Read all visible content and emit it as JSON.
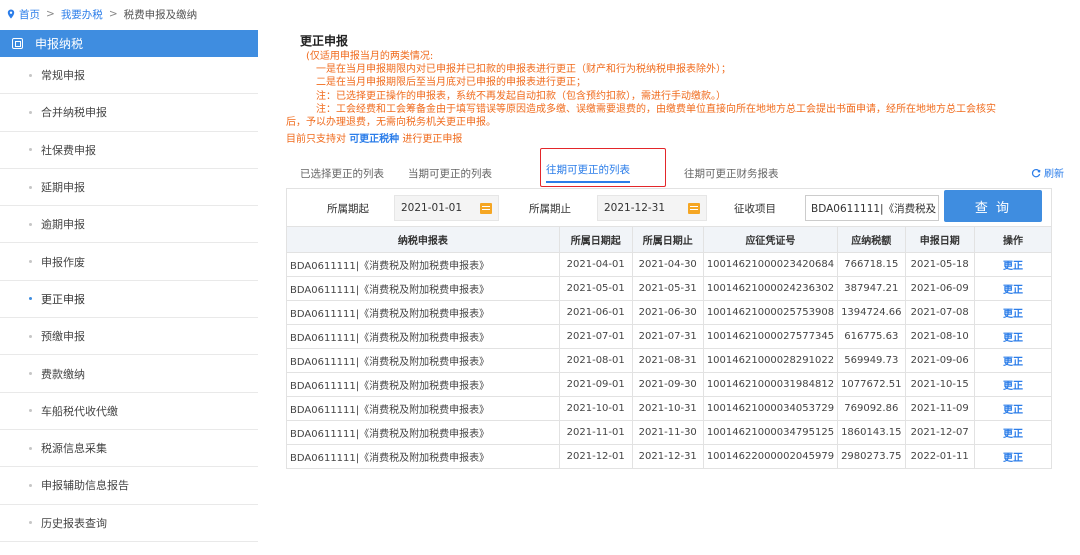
{
  "breadcrumb": [
    "首页",
    "我要办税",
    "税费申报及缴纳"
  ],
  "sidebar": {
    "header": "申报纳税",
    "items": [
      {
        "label": "常规申报"
      },
      {
        "label": "合并纳税申报"
      },
      {
        "label": "社保费申报"
      },
      {
        "label": "延期申报"
      },
      {
        "label": "逾期申报"
      },
      {
        "label": "申报作废"
      },
      {
        "label": "更正申报",
        "active": true
      },
      {
        "label": "预缴申报"
      },
      {
        "label": "费款缴纳"
      },
      {
        "label": "车船税代收代缴"
      },
      {
        "label": "税源信息采集"
      },
      {
        "label": "申报辅助信息报告"
      },
      {
        "label": "历史报表查询"
      }
    ]
  },
  "main": {
    "title": "更正申报",
    "notes": [
      "(仅适用申报当月的两类情况:",
      "一是在当月申报期限内对已申报并已扣款的申报表进行更正（财产和行为税纳税申报表除外）；",
      "二是在当月申报期限后至当月底对已申报的申报表进行更正；",
      "注：已选择更正操作的申报表，系统不再发起自动扣款（包含预约扣款），需进行手动缴款。）",
      "注：工会经费和工会筹备金由于填写错误等原因造成多缴、误缴需要退费的，由缴费单位直接向所在地地方总工会提出书面申请，经所在地地方总工会核实",
      "后，予以办理退费，无需向税务机关更正申报。"
    ],
    "support_prefix": "目前只支持对",
    "support_link": "可更正税种",
    "support_suffix": "进行更正申报"
  },
  "tabs": [
    "已选择更正的列表",
    "当期可更正的列表",
    "往期可更正的列表",
    "往期可更正财务报表"
  ],
  "active_tab": "往期可更正的列表",
  "refresh_label": "刷新",
  "filter": {
    "start_label": "所属期起",
    "start_value": "2021-01-01",
    "end_label": "所属期止",
    "end_value": "2021-12-31",
    "item_label": "征收项目",
    "item_value": "BDA0611111|《消费税及",
    "query_label": "查 询"
  },
  "table": {
    "headers": [
      "纳税申报表",
      "所属日期起",
      "所属日期止",
      "应征凭证号",
      "应纳税额",
      "申报日期",
      "操作"
    ],
    "rows": [
      [
        "BDA0611111|《消费税及附加税费申报表》",
        "2021-04-01",
        "2021-04-30",
        "10014621000023420684",
        "766718.15",
        "2021-05-18",
        "更正"
      ],
      [
        "BDA0611111|《消费税及附加税费申报表》",
        "2021-05-01",
        "2021-05-31",
        "10014621000024236302",
        "387947.21",
        "2021-06-09",
        "更正"
      ],
      [
        "BDA0611111|《消费税及附加税费申报表》",
        "2021-06-01",
        "2021-06-30",
        "10014621000025753908",
        "1394724.66",
        "2021-07-08",
        "更正"
      ],
      [
        "BDA0611111|《消费税及附加税费申报表》",
        "2021-07-01",
        "2021-07-31",
        "10014621000027577345",
        "616775.63",
        "2021-08-10",
        "更正"
      ],
      [
        "BDA0611111|《消费税及附加税费申报表》",
        "2021-08-01",
        "2021-08-31",
        "10014621000028291022",
        "569949.73",
        "2021-09-06",
        "更正"
      ],
      [
        "BDA0611111|《消费税及附加税费申报表》",
        "2021-09-01",
        "2021-09-30",
        "10014621000031984812",
        "1077672.51",
        "2021-10-15",
        "更正"
      ],
      [
        "BDA0611111|《消费税及附加税费申报表》",
        "2021-10-01",
        "2021-10-31",
        "10014621000034053729",
        "769092.86",
        "2021-11-09",
        "更正"
      ],
      [
        "BDA0611111|《消费税及附加税费申报表》",
        "2021-11-01",
        "2021-11-30",
        "10014621000034795125",
        "1860143.15",
        "2021-12-07",
        "更正"
      ],
      [
        "BDA0611111|《消费税及附加税费申报表》",
        "2021-12-01",
        "2021-12-31",
        "10014622000002045979",
        "2980273.75",
        "2022-01-11",
        "更正"
      ]
    ]
  },
  "colors": {
    "accent": "#3f8de0",
    "note": "#f06b1d",
    "highlight": "#e3262a"
  }
}
